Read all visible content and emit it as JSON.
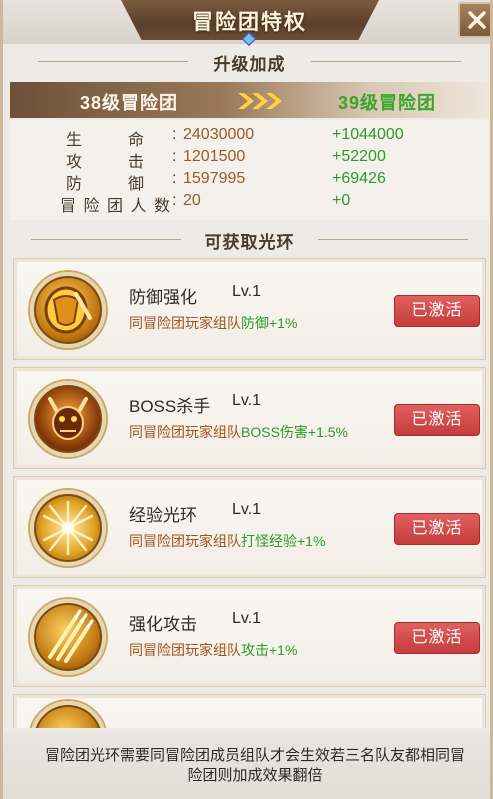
{
  "window": {
    "title": "冒险团特权"
  },
  "upgrade": {
    "section_title": "升级加成",
    "from_level": "38级冒险团",
    "to_level": "39级冒险团",
    "stats": [
      {
        "label": "生命",
        "value": "24030000",
        "increase": "+1044000"
      },
      {
        "label": "攻击",
        "value": "1201500",
        "increase": "+52200"
      },
      {
        "label": "防御",
        "value": "1597995",
        "increase": "+69426"
      },
      {
        "label": "冒险团人数",
        "value": "20",
        "increase": "+0"
      }
    ]
  },
  "auras": {
    "section_title": "可获取光环",
    "items": [
      {
        "name": "防御强化",
        "level": "Lv.1",
        "desc_prefix": "同冒险团玩家组队",
        "desc_effect": "防御+1%",
        "button": "已激活",
        "icon": "shield-icon"
      },
      {
        "name": "BOSS杀手",
        "level": "Lv.1",
        "desc_prefix": "同冒险团玩家组队",
        "desc_effect": "BOSS伤害+1.5%",
        "button": "已激活",
        "icon": "demon-icon"
      },
      {
        "name": "经验光环",
        "level": "Lv.1",
        "desc_prefix": "同冒险团玩家组队",
        "desc_effect": "打怪经验+1%",
        "button": "已激活",
        "icon": "light-rays-icon"
      },
      {
        "name": "强化攻击",
        "level": "Lv.1",
        "desc_prefix": "同冒险团玩家组队",
        "desc_effect": "攻击+1%",
        "button": "已激活",
        "icon": "swords-icon"
      }
    ]
  },
  "footer": {
    "note": "冒险团光环需要同冒险团成员组队才会生效若三名队友都相同冒险团则加成效果翻倍"
  },
  "colors": {
    "title_plate": "#6b4d36",
    "increase_green": "#2e9a2a",
    "value_orange": "#9a5a25",
    "button_red": "#d24a4a"
  }
}
